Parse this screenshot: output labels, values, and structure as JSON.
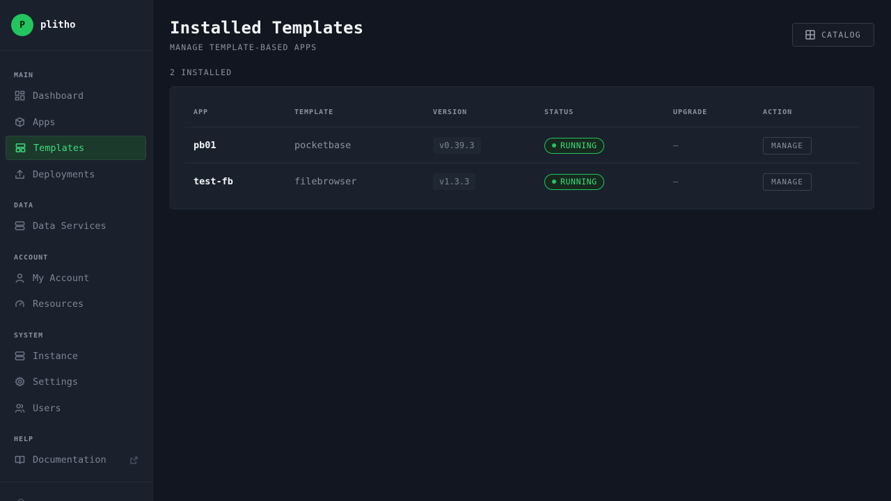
{
  "brand": {
    "logo_letter": "P",
    "name": "plitho"
  },
  "sidebar": {
    "sections": [
      {
        "label": "MAIN"
      },
      {
        "label": "DATA"
      },
      {
        "label": "ACCOUNT"
      },
      {
        "label": "SYSTEM"
      },
      {
        "label": "HELP"
      }
    ],
    "items": [
      {
        "label": "Dashboard",
        "icon": "dashboard-icon"
      },
      {
        "label": "Apps",
        "icon": "cube-icon"
      },
      {
        "label": "Templates",
        "icon": "templates-icon",
        "active": true
      },
      {
        "label": "Deployments",
        "icon": "upload-icon"
      },
      {
        "label": "Data Services",
        "icon": "server-icon"
      },
      {
        "label": "My Account",
        "icon": "user-icon"
      },
      {
        "label": "Resources",
        "icon": "gauge-icon"
      },
      {
        "label": "Instance",
        "icon": "server-icon"
      },
      {
        "label": "Settings",
        "icon": "gear-icon"
      },
      {
        "label": "Users",
        "icon": "users-icon"
      },
      {
        "label": "Documentation",
        "icon": "book-icon",
        "external": true
      }
    ]
  },
  "header": {
    "title": "Installed Templates",
    "subtitle": "MANAGE TEMPLATE-BASED APPS",
    "catalog_label": "CATALOG",
    "installed_count": "2 INSTALLED"
  },
  "table": {
    "columns": [
      "APP",
      "TEMPLATE",
      "VERSION",
      "STATUS",
      "UPGRADE",
      "ACTION"
    ],
    "rows": [
      {
        "app": "pb01",
        "template": "pocketbase",
        "version": "v0.39.3",
        "status": "RUNNING",
        "upgrade": "—",
        "action": "MANAGE"
      },
      {
        "app": "test-fb",
        "template": "filebrowser",
        "version": "v1.3.3",
        "status": "RUNNING",
        "upgrade": "—",
        "action": "MANAGE"
      }
    ]
  },
  "colors": {
    "accent": "#22c55e",
    "background": "#121620",
    "sidebar": "#1a202c"
  }
}
